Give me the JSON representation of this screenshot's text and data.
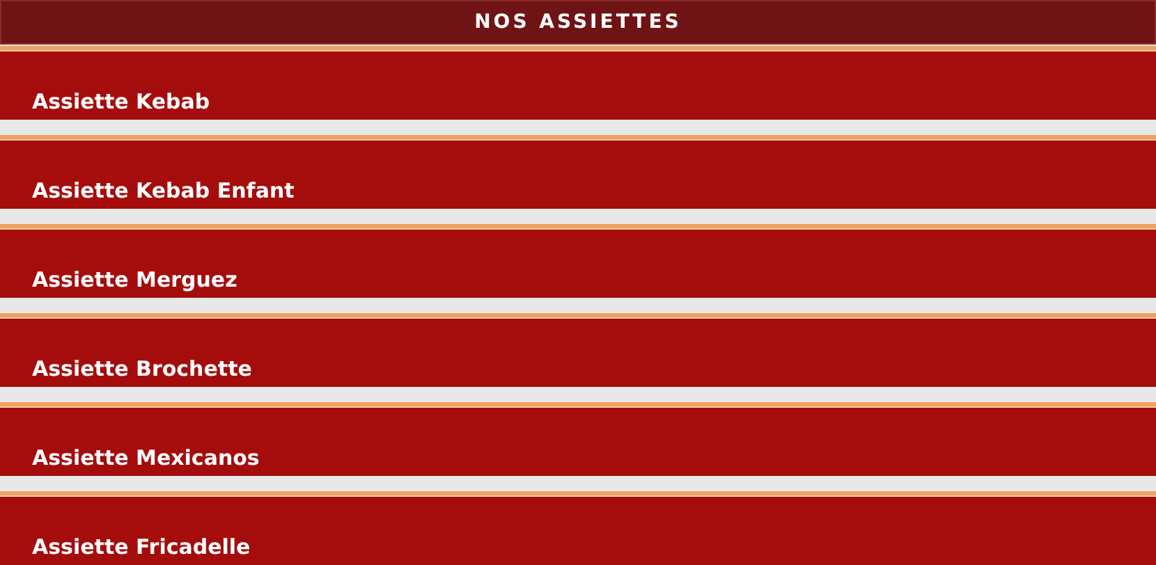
{
  "header": {
    "title": "NOS ASSIETTES"
  },
  "items": [
    {
      "label": "Assiette Kebab"
    },
    {
      "label": "Assiette Kebab Enfant"
    },
    {
      "label": "Assiette Merguez"
    },
    {
      "label": "Assiette Brochette"
    },
    {
      "label": "Assiette Mexicanos"
    },
    {
      "label": "Assiette Fricadelle"
    }
  ]
}
